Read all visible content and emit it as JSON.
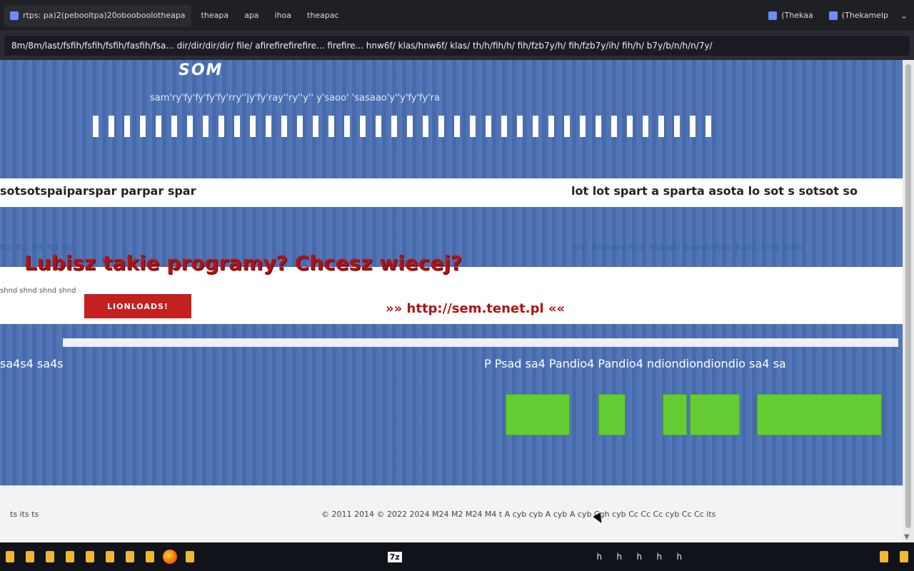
{
  "browser": {
    "tabs": [
      {
        "label": "rtps: pa)2(pebooltpa)20obooboolotheapa"
      },
      {
        "label": "theapa"
      },
      {
        "label": "apa"
      },
      {
        "label": "ihoa"
      },
      {
        "label": "theapac"
      },
      {
        "label": "(Thekaa"
      },
      {
        "label": "(Thekamelp"
      }
    ],
    "url": "8m/8m/last/fsfih/fsfih/fsfih/fasfih/fsa... dir/dir/dir/dir/ file/ afirefirefirefire... firefire... hnw6f/ klas/hnw6f/ klas/ th/h/fih/h/ fih/fzb7y/h/ fih/fzb7y/ih/ fih/h/ b7y/b/n/h/n/7y/"
  },
  "page": {
    "brand": "SOM",
    "tagline": "sam'ry'fy'fy'fy'fy'rry''jy'fy'ray''ry''y'' y'saoo' 'sasaao'y''y'fy'fy'ra",
    "band_left": "sotsotspaiparspar parpar spar",
    "band_right": "lot lot spart a sparta asota lo sot s sotsot so",
    "links_left": "ftd. ftd. ftd. ftd. ftd.",
    "links_right": "Rird. Rirdownl Rird. Ridownl downlo Rido. Rirdo. Rinlo Rinlo",
    "promo_small": "shnd shnd shnd shnd",
    "promo_title": "Lubisz takie programy? Chcesz wiecej?",
    "promo_banner": "LIONLOADS!",
    "promo_link": "»»  http://sem.tenet.pl  ««",
    "section_left": "sa4s4 sa4s",
    "section_right": "P Psad sa4 Pandio4 Pandio4 ndiondiondiondio sa4 sa",
    "green_buttons": [
      "",
      "",
      "",
      "",
      ""
    ],
    "footer_left": "ts   its   ts",
    "footer_copy": "© 2011 2014 © 2022 2024 M24 M2 M24 M4   t  A cyb cyb  A cyb  A cyb Cgh cyb Cc Cc Cc cyb Cc Cc its"
  },
  "taskbar": {
    "items": [
      "folder",
      "folder",
      "folder",
      "folder",
      "folder",
      "folder",
      "folder",
      "folder",
      "firefox",
      "folder",
      "7z"
    ],
    "zip_label": "7z",
    "right_items": [
      "h",
      "h",
      "h",
      "h",
      "h"
    ],
    "clock": ""
  },
  "colors": {
    "hero_blue": "#4a70b4",
    "promo_red": "#b01212",
    "button_green": "#64cc33"
  }
}
